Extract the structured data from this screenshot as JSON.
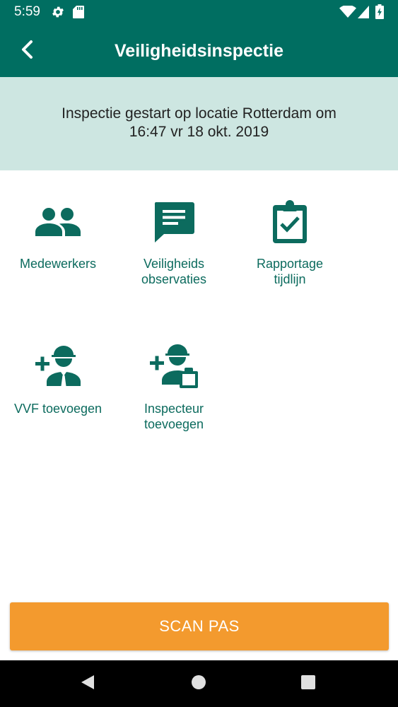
{
  "status_bar": {
    "time": "5:59",
    "icons": [
      "settings-icon",
      "sd-card-icon",
      "wifi-icon",
      "signal-icon",
      "battery-icon"
    ]
  },
  "app_bar": {
    "title": "Veiligheidsinspectie",
    "back_icon": "chevron-left-icon"
  },
  "banner": {
    "text": "Inspectie gestart op locatie Rotterdam om 16:47 vr 18 okt. 2019"
  },
  "menu": {
    "items": [
      {
        "label": "Medewerkers",
        "icon": "people-icon"
      },
      {
        "label": "Veiligheids\nobservaties",
        "icon": "comment-icon"
      },
      {
        "label": "Rapportage\ntijdlijn",
        "icon": "clipboard-check-icon"
      },
      {
        "label": "VVF toevoegen",
        "icon": "add-worker-icon"
      },
      {
        "label": "Inspecteur\ntoevoegen",
        "icon": "add-inspector-icon"
      }
    ]
  },
  "scan_button": {
    "label": "SCAN PAS"
  },
  "nav_bar": {
    "icons": [
      "back-triangle-icon",
      "home-circle-icon",
      "recents-square-icon"
    ]
  },
  "colors": {
    "primary": "#006e61",
    "banner": "#cde6e1",
    "accent": "#f39a2e",
    "icon_text": "#0c6b5e"
  }
}
